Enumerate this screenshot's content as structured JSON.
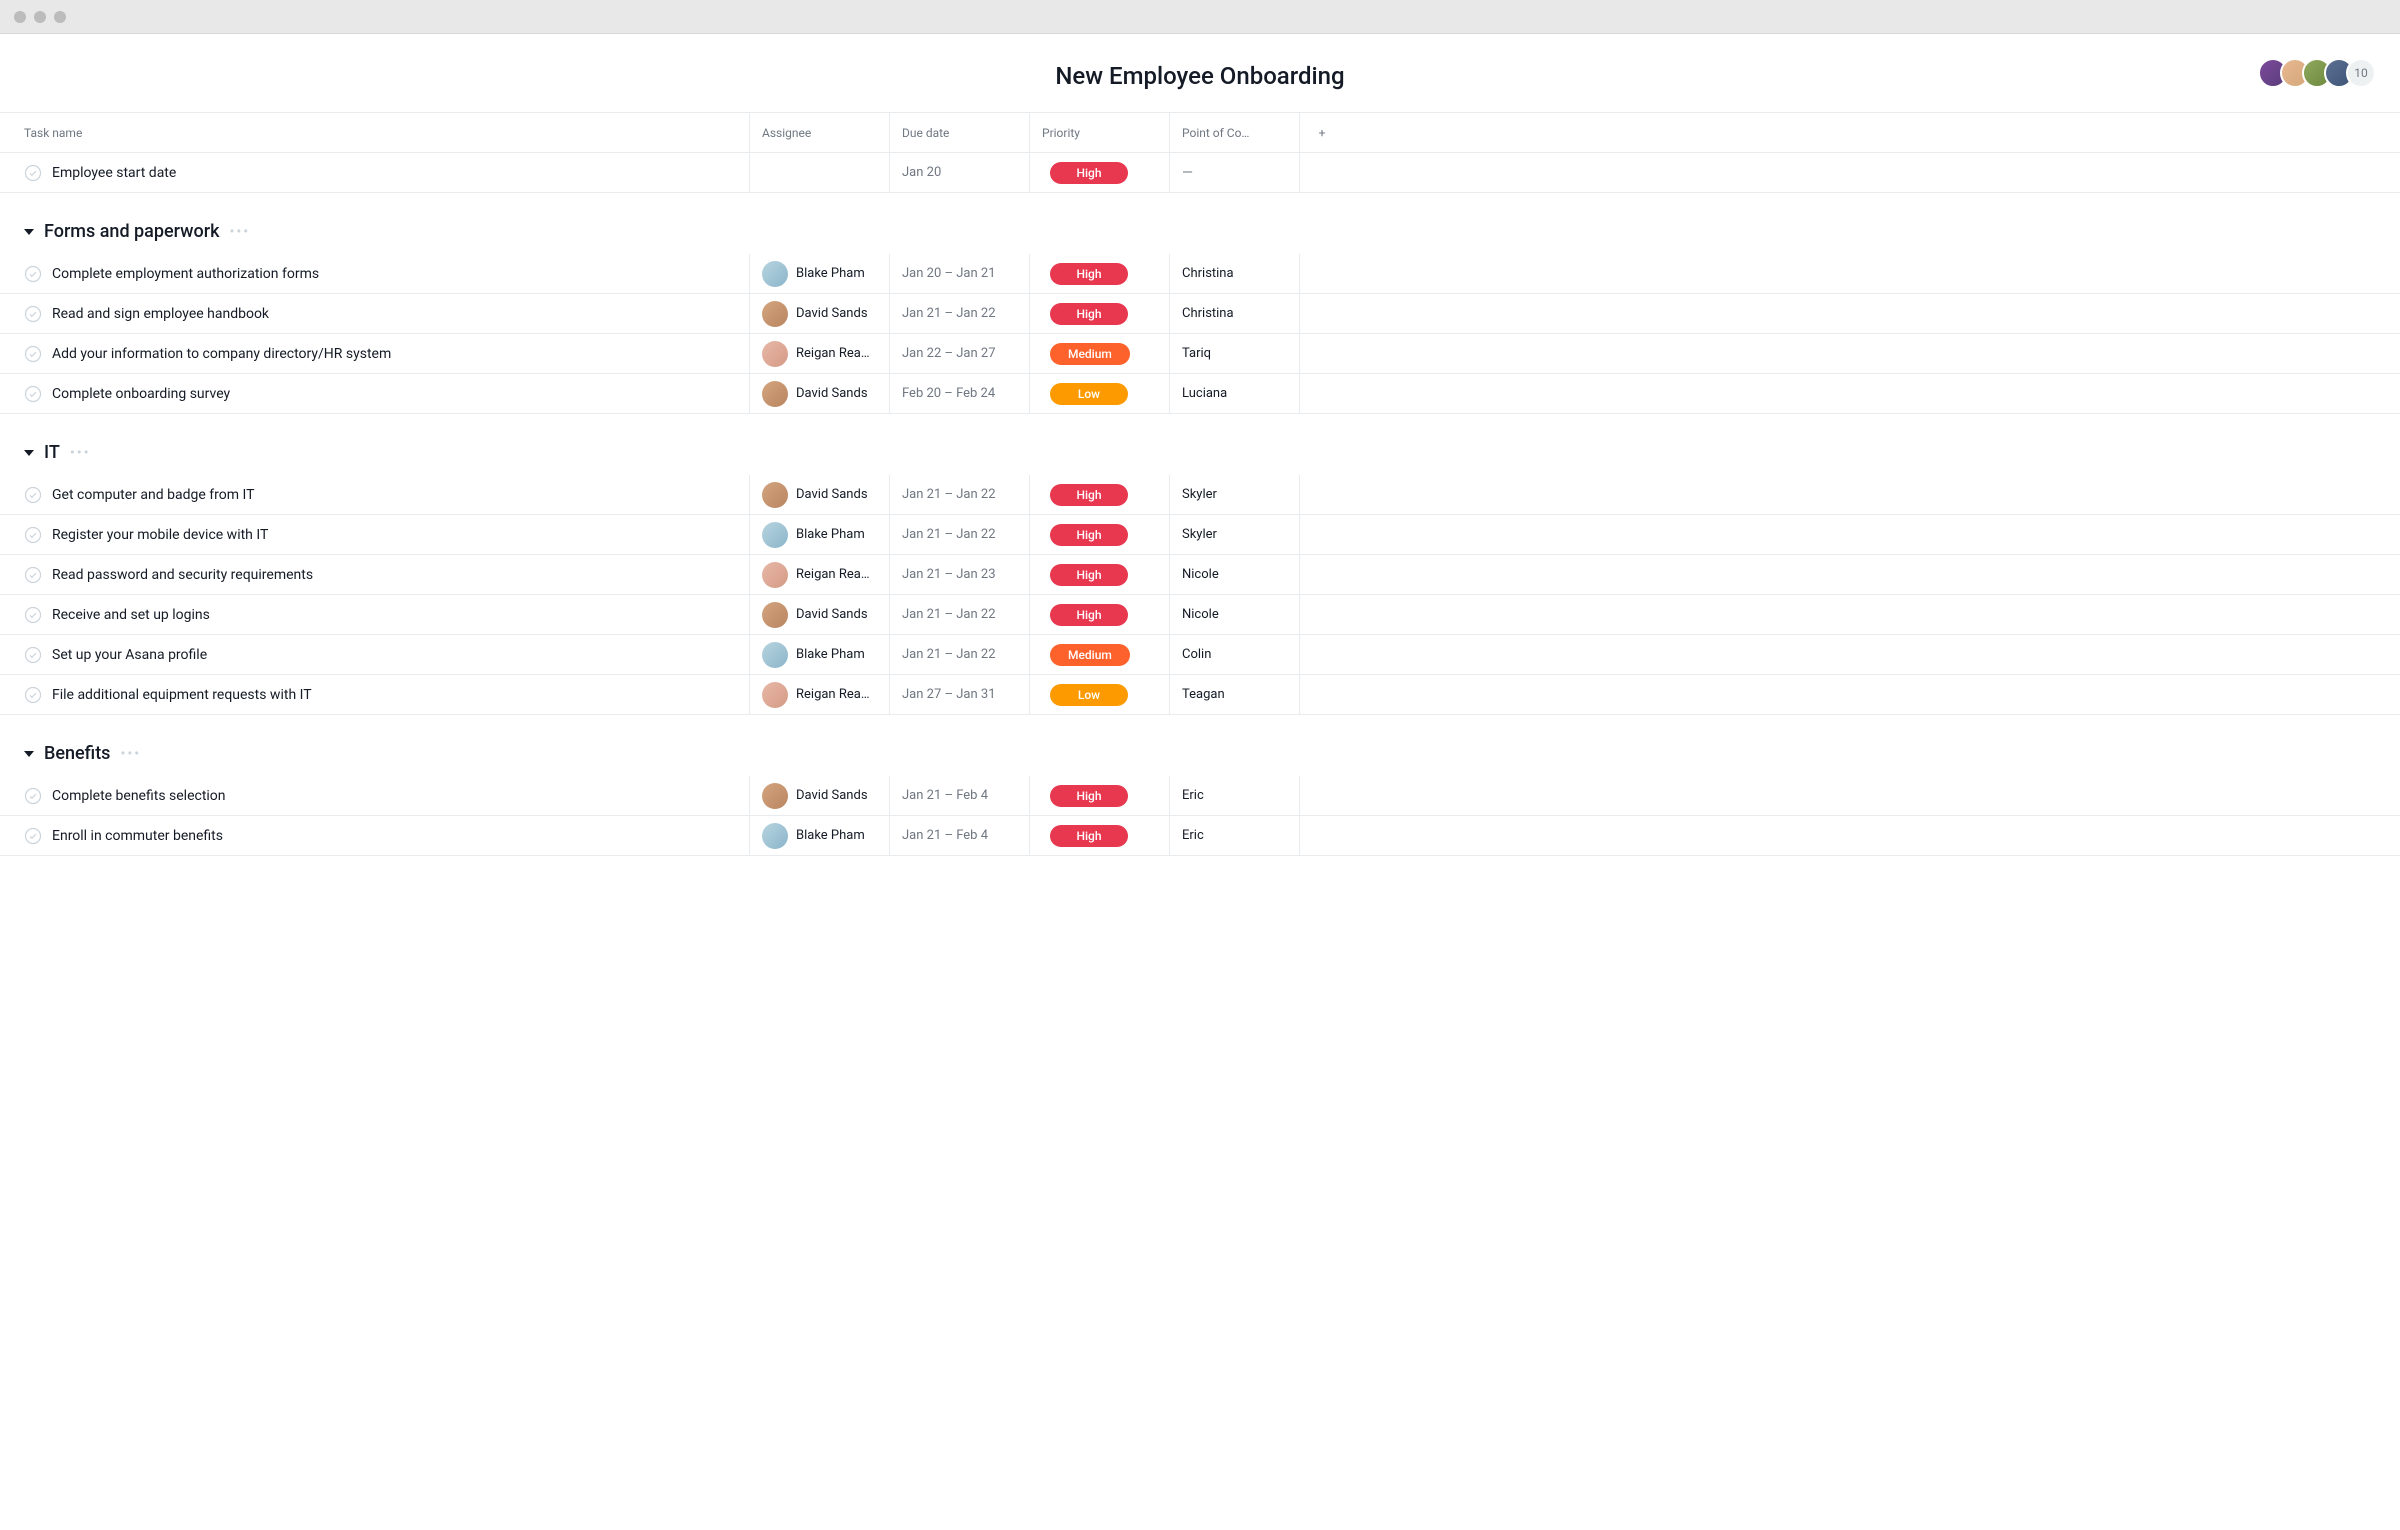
{
  "page_title": "New Employee Onboarding",
  "member_overflow": "10",
  "columns": {
    "task": "Task name",
    "assignee": "Assignee",
    "due": "Due date",
    "priority": "Priority",
    "poc": "Point of Co…",
    "add": "+"
  },
  "top_task": {
    "name": "Employee start date",
    "due": "Jan 20",
    "priority": "High",
    "poc_dash": "—"
  },
  "sections": [
    {
      "title": "Forms and paperwork",
      "tasks": [
        {
          "name": "Complete employment authorization forms",
          "assignee": "Blake Pham",
          "avatar": "blake",
          "due": "Jan 20 – Jan 21",
          "priority": "High",
          "poc": "Christina"
        },
        {
          "name": "Read and sign employee handbook",
          "assignee": "David Sands",
          "avatar": "david",
          "due": "Jan 21 – Jan 22",
          "priority": "High",
          "poc": "Christina"
        },
        {
          "name": "Add your information to company directory/HR system",
          "assignee": "Reigan Rea…",
          "avatar": "reigan",
          "due": "Jan 22 – Jan 27",
          "priority": "Medium",
          "poc": "Tariq"
        },
        {
          "name": "Complete onboarding survey",
          "assignee": "David Sands",
          "avatar": "david",
          "due": "Feb 20 – Feb 24",
          "priority": "Low",
          "poc": "Luciana"
        }
      ]
    },
    {
      "title": "IT",
      "tasks": [
        {
          "name": "Get computer and badge from IT",
          "assignee": "David Sands",
          "avatar": "david",
          "due": "Jan 21 – Jan 22",
          "priority": "High",
          "poc": "Skyler"
        },
        {
          "name": "Register your mobile device with IT",
          "assignee": "Blake Pham",
          "avatar": "blake",
          "due": "Jan 21 – Jan 22",
          "priority": "High",
          "poc": "Skyler"
        },
        {
          "name": "Read password and security requirements",
          "assignee": "Reigan Rea…",
          "avatar": "reigan",
          "due": "Jan 21 – Jan 23",
          "priority": "High",
          "poc": "Nicole"
        },
        {
          "name": "Receive and set up logins",
          "assignee": "David Sands",
          "avatar": "david",
          "due": "Jan 21 – Jan 22",
          "priority": "High",
          "poc": "Nicole"
        },
        {
          "name": "Set up your Asana profile",
          "assignee": "Blake Pham",
          "avatar": "blake",
          "due": "Jan 21 – Jan 22",
          "priority": "Medium",
          "poc": "Colin"
        },
        {
          "name": "File additional equipment requests with IT",
          "assignee": "Reigan Rea…",
          "avatar": "reigan",
          "due": "Jan 27 – Jan 31",
          "priority": "Low",
          "poc": "Teagan"
        }
      ]
    },
    {
      "title": "Benefits",
      "tasks": [
        {
          "name": "Complete benefits selection",
          "assignee": "David Sands",
          "avatar": "david",
          "due": "Jan 21 – Feb 4",
          "priority": "High",
          "poc": "Eric"
        },
        {
          "name": "Enroll in commuter benefits",
          "assignee": "Blake Pham",
          "avatar": "blake",
          "due": "Jan 21 – Feb 4",
          "priority": "High",
          "poc": "Eric"
        }
      ]
    }
  ]
}
